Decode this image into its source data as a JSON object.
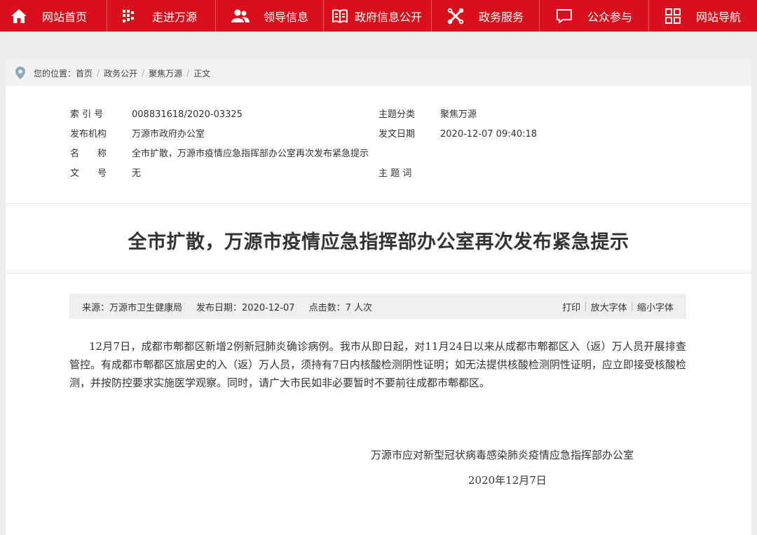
{
  "nav": {
    "items": [
      {
        "label": "网站首页",
        "icon": "home-icon"
      },
      {
        "label": "走进万源",
        "icon": "grid-dots-icon"
      },
      {
        "label": "领导信息",
        "icon": "people-icon"
      },
      {
        "label": "政府信息公开",
        "icon": "open-book-icon"
      },
      {
        "label": "政务服务",
        "icon": "tools-icon"
      },
      {
        "label": "公众参与",
        "icon": "chat-icon"
      },
      {
        "label": "网站导航",
        "icon": "sitemap-icon"
      }
    ]
  },
  "breadcrumb": {
    "prefix": "您的位置：",
    "items": [
      "首页",
      "政务公开",
      "聚焦万源",
      "正文"
    ],
    "separator": "/"
  },
  "meta": {
    "index_label": "索 引 号",
    "index_value": "008831618/2020-03325",
    "topic_label": "主题分类",
    "topic_value": "聚焦万源",
    "publisher_label": "发布机构",
    "publisher_value": "万源市政府办公室",
    "date_label": "发文日期",
    "date_value": "2020-12-07 09:40:18",
    "name_label": "名　　称",
    "name_value": "全市扩散，万源市疫情应急指挥部办公室再次发布紧急提示",
    "docno_label": "文　　号",
    "docno_value": "无",
    "keywords_label": "主 题 词",
    "keywords_value": ""
  },
  "article": {
    "title": "全市扩散，万源市疫情应急指挥部办公室再次发布紧急提示",
    "source": "来源：万源市卫生健康局",
    "publish_date": "发布日期：2020-12-07",
    "views": "点击数：7 人次",
    "print_label": "打印",
    "enlarge_label": "放大字体",
    "shrink_label": "缩小字体",
    "tool_separator": "|",
    "body": "12月7日，成都市郫都区新增2例新冠肺炎确诊病例。我市从即日起，对11月24日以来从成都市郫都区入（返）万人员开展排查管控。有成都市郫都区旅居史的入（返）万人员，须持有7日内核酸检测阴性证明；如无法提供核酸检测阴性证明，应立即接受核酸检测，并按防控要求实施医学观察。同时，请广大市民如非必要暂时不要前往成都市郫都区。",
    "signature": "万源市应对新型冠状病毒感染肺炎疫情应急指挥部办公室",
    "signature_date": "2020年12月7日"
  },
  "colors": {
    "nav_bg": "#d7101b",
    "page_bg": "#ececec",
    "card_bg": "#ffffff",
    "infobar_bg": "#efefef",
    "pin_icon": "#8fa8bf"
  }
}
